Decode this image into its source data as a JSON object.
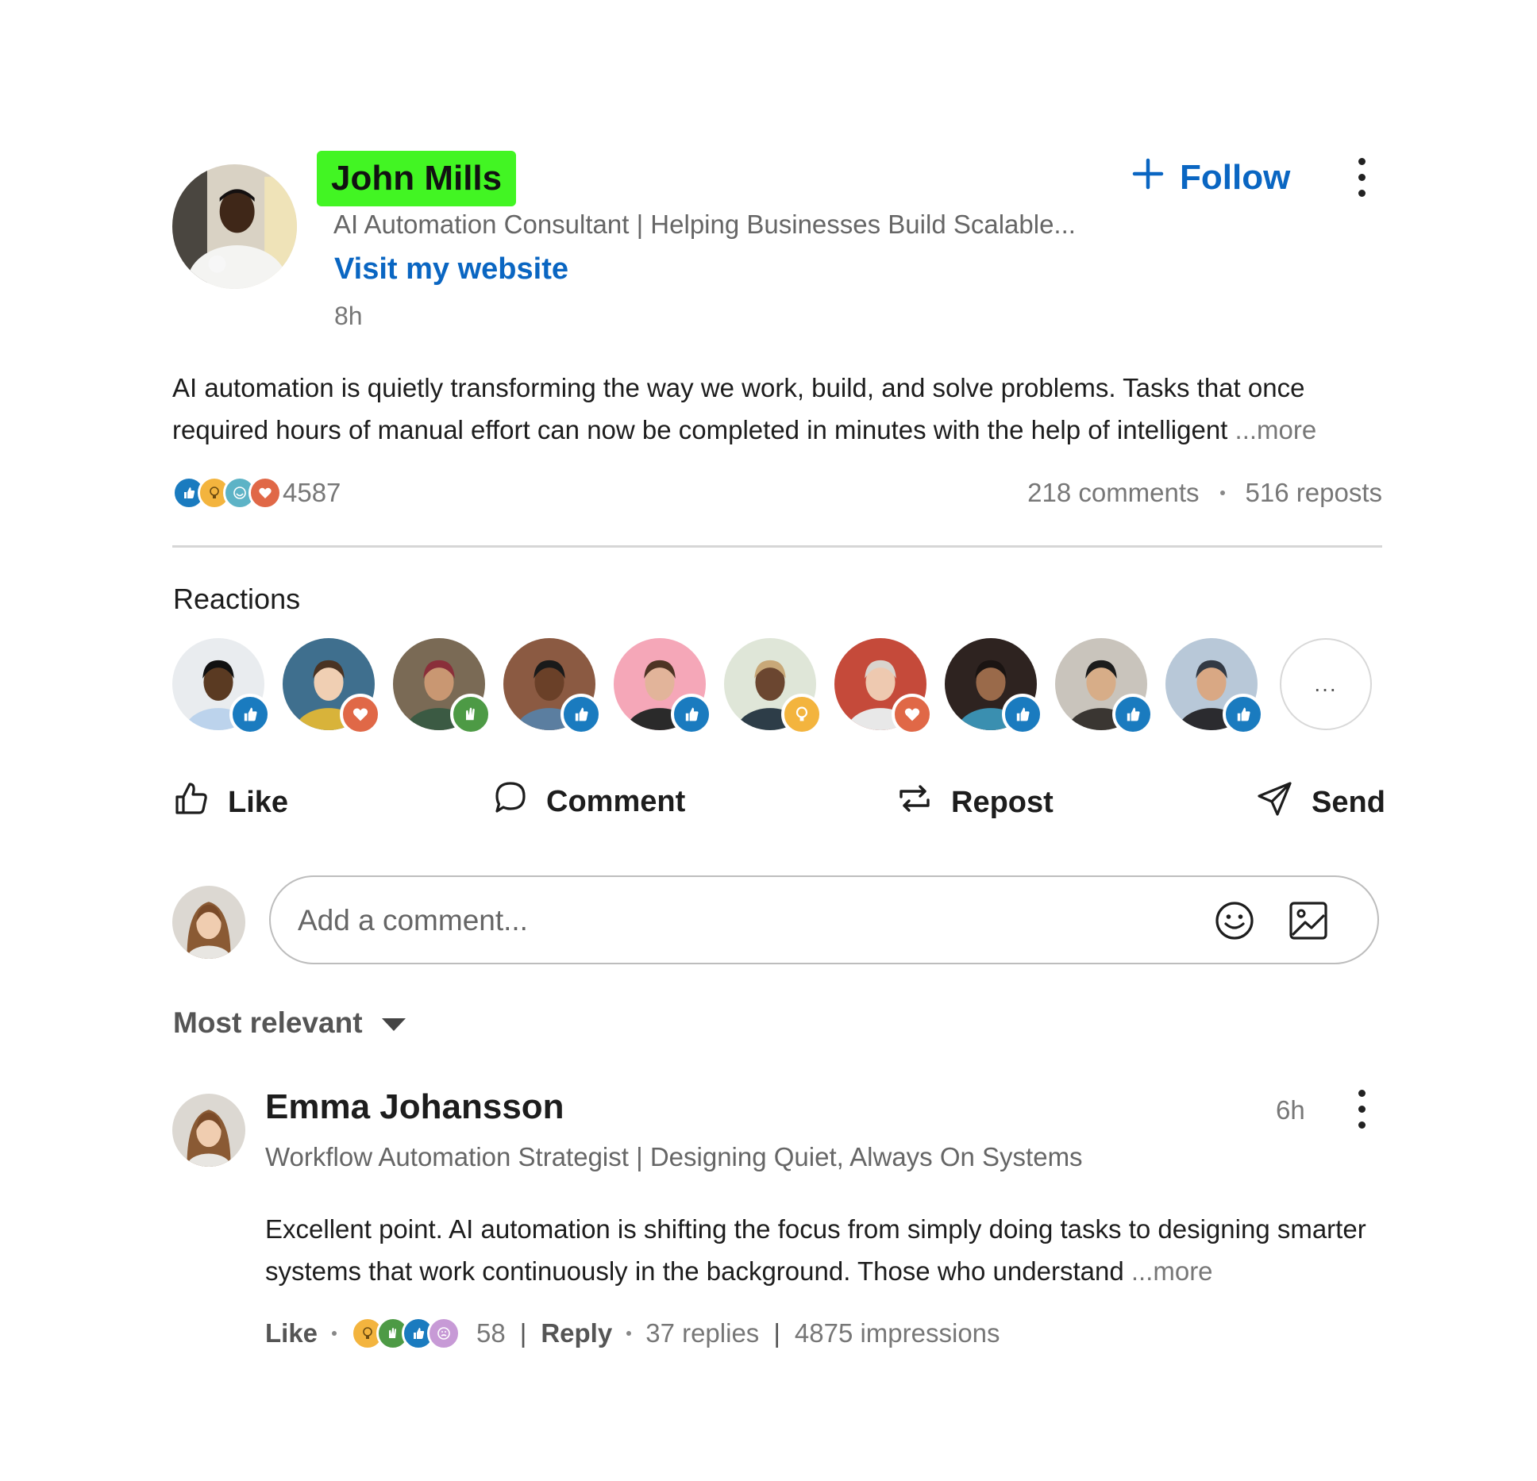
{
  "post": {
    "author_name": "John Mills",
    "author_headline": "AI Automation Consultant | Helping Businesses Build Scalable...",
    "website_link": "Visit my website",
    "time": "8h",
    "follow_label": "Follow",
    "body": "AI automation is quietly transforming the way we work, build, and solve problems. Tasks that once required hours of manual effort can now be completed in minutes with the help of intelligent",
    "more_label": "...more",
    "reaction_count": "4587",
    "comments": "218 comments",
    "reposts": "516 reposts"
  },
  "reactions": {
    "title": "Reactions",
    "more_label": "...",
    "people": [
      {
        "bg": "#e9ecef",
        "skin": "#5a3a22",
        "hair": "#111111",
        "shirt": "#bcd3ec",
        "reaction": "like"
      },
      {
        "bg": "#3f6f8e",
        "skin": "#f0cfb3",
        "hair": "#4a3323",
        "shirt": "#d8b33a",
        "reaction": "love"
      },
      {
        "bg": "#7a6a55",
        "skin": "#c99772",
        "hair": "#8a2f3a",
        "shirt": "#3b5a43",
        "reaction": "celebrate"
      },
      {
        "bg": "#8b5a42",
        "skin": "#6a4028",
        "hair": "#1a1a1a",
        "shirt": "#5b7ea0",
        "reaction": "like"
      },
      {
        "bg": "#f5a7b8",
        "skin": "#e2b49a",
        "hair": "#4e3424",
        "shirt": "#2a2a2a",
        "reaction": "like"
      },
      {
        "bg": "#dfe6d8",
        "skin": "#6b4630",
        "hair": "#c8a878",
        "shirt": "#2d3d48",
        "reaction": "insightful"
      },
      {
        "bg": "#c54a3a",
        "skin": "#eec9b0",
        "hair": "#d9d4ce",
        "shirt": "#e8e8e8",
        "reaction": "love"
      },
      {
        "bg": "#2e2320",
        "skin": "#9a6a4a",
        "hair": "#1a1412",
        "shirt": "#3a8fb0",
        "reaction": "like"
      },
      {
        "bg": "#c9c4bc",
        "skin": "#d7ad88",
        "hair": "#1c1c1c",
        "shirt": "#3a3632",
        "reaction": "like"
      },
      {
        "bg": "#b8c8d8",
        "skin": "#d9a884",
        "hair": "#333a44",
        "shirt": "#2b2b2f",
        "reaction": "like"
      }
    ]
  },
  "actions": {
    "like": "Like",
    "comment": "Comment",
    "repost": "Repost",
    "send": "Send"
  },
  "comment_input": {
    "placeholder": "Add a comment..."
  },
  "sort": {
    "label": "Most relevant"
  },
  "comment": {
    "author_name": "Emma Johansson",
    "author_headline": "Workflow Automation Strategist | Designing Quiet, Always On Systems",
    "time": "6h",
    "body": "Excellent point. AI automation is shifting the focus from simply doing tasks to designing smarter systems that work continuously in the background. Those who understand",
    "more_label": "...more",
    "like_label": "Like",
    "reaction_count": "58",
    "reply_label": "Reply",
    "replies": "37 replies",
    "impressions": "4875 impressions"
  },
  "colors": {
    "link_blue": "#0a66c2",
    "name_highlight": "#42f523",
    "like_blue": "#1a7bbf",
    "love_red": "#e06847",
    "celebrate_green": "#4d9a45",
    "insightful_yellow": "#f3b43e",
    "funny_teal": "#5db3c6",
    "support_purple": "#c79ad6"
  }
}
